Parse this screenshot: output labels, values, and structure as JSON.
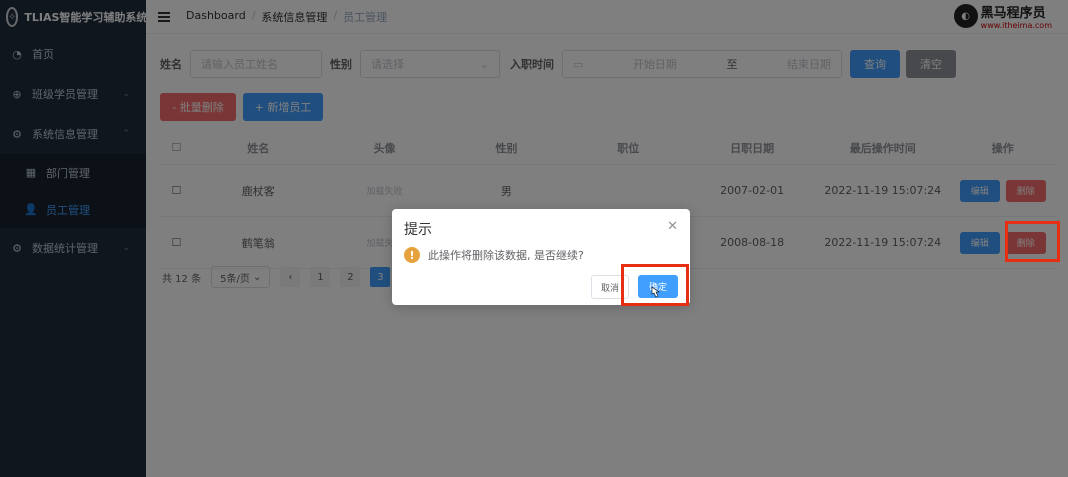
{
  "sidebar": {
    "logo_text": "TLIAS智能学习辅助系统",
    "items": [
      {
        "label": "首页",
        "icon": "dashboard-icon"
      },
      {
        "label": "班级学员管理",
        "icon": "plus-circle-icon"
      },
      {
        "label": "系统信息管理",
        "icon": "gear-icon"
      },
      {
        "label": "部门管理",
        "icon": "grid-icon"
      },
      {
        "label": "员工管理",
        "icon": "user-icon"
      },
      {
        "label": "数据统计管理",
        "icon": "gear-icon"
      }
    ]
  },
  "header": {
    "breadcrumb": [
      "Dashboard",
      "系统信息管理",
      "员工管理"
    ],
    "brand_title": "黑马程序员",
    "brand_url": "www.itheima.com"
  },
  "search": {
    "name_label": "姓名",
    "name_placeholder": "请输入员工姓名",
    "gender_label": "性别",
    "gender_placeholder": "请选择",
    "date_label": "入职时间",
    "start_placeholder": "开始日期",
    "to": "至",
    "end_placeholder": "结束日期",
    "query_btn": "查询",
    "clear_btn": "清空"
  },
  "actions": {
    "batch_delete": "- 批量删除",
    "add_employee": "+ 新增员工"
  },
  "table": {
    "headers": [
      "",
      "姓名",
      "头像",
      "性别",
      "职位",
      "日职日期",
      "最后操作时间",
      "操作"
    ],
    "rows": [
      {
        "name": "鹿杖客",
        "avatar": "加载失败",
        "gender": "男",
        "job": "",
        "entry": "2007-02-01",
        "updated": "2022-11-19 15:07:24"
      },
      {
        "name": "鹤笔翁",
        "avatar": "加载失败",
        "gender": "",
        "job": "",
        "entry": "2008-08-18",
        "updated": "2022-11-19 15:07:24"
      }
    ],
    "edit_label": "编辑",
    "delete_label": "删除"
  },
  "pagination": {
    "total": "共 12 条",
    "page_size": "5条/页",
    "pages": [
      "1",
      "2",
      "3"
    ],
    "current": "3"
  },
  "dialog": {
    "title": "提示",
    "message": "此操作将删除该数据, 是否继续?",
    "cancel": "取消",
    "confirm": "确定"
  },
  "colors": {
    "primary": "#409eff",
    "danger": "#f56c6c",
    "sidebar": "#1f2d3d",
    "highlight": "#e52e12"
  }
}
